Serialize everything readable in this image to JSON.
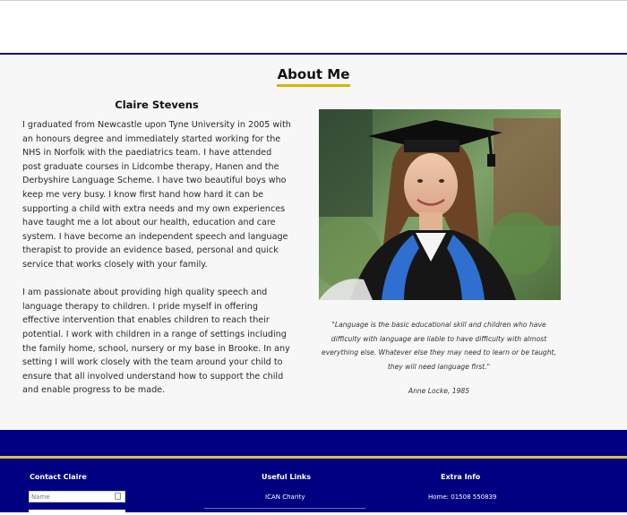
{
  "about": {
    "title": "About Me",
    "name": "Claire Stevens",
    "bio_paragraphs": [
      "I graduated from Newcastle upon Tyne University in 2005 with an honours degree and immediately started working for the NHS in Norfolk with the paediatrics team. I have attended post graduate courses in Lidcombe therapy, Hanen and the Derbyshire Language Scheme. I have two beautiful boys who keep me very busy. I know first hand how hard it can be supporting a child with extra needs and my own experiences have taught me a lot about our health, education and care system. I have become an independent speech and language therapist to provide an evidence based, personal and quick service that works closely with your family.",
      "I am passionate about providing high quality speech and language therapy to children. I pride myself in offering effective intervention that enables children to reach their potential. I work with children in a range of settings including the family home, school, nursery or my base in Brooke. In any setting I will work closely with the team around your child to ensure that all involved understand how to support the child and enable progress to be made."
    ],
    "quote": "\"Language is the basic educational skill and children who have difficulty with language are liable to have difficulty with almost everything else. Whatever else they may need to learn or be taught, they will need language first.\"",
    "quote_author": "Anne Locke, 1985"
  },
  "footer": {
    "contact_title": "Contact Claire",
    "name_placeholder": "Name",
    "links_title": "Useful Links",
    "link_1": "ICAN Charity",
    "extra_title": "Extra Info",
    "phone": "Home: 01508 550839"
  },
  "colors": {
    "footer_bg": "#000080",
    "accent_gold": "#d9b400",
    "header_rule": "#0a0a73"
  }
}
